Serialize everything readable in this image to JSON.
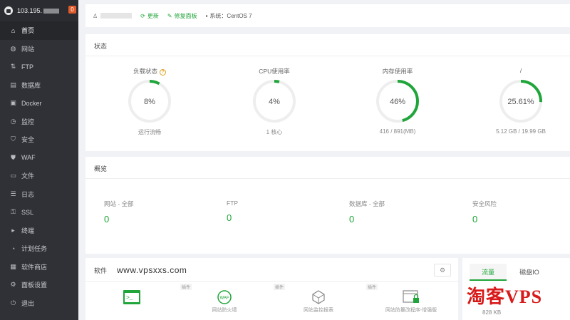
{
  "sidebar": {
    "ip": "103.195.",
    "badge": "0",
    "items": [
      {
        "label": "首页",
        "icon": "home-icon",
        "glyph": "⌂",
        "active": true
      },
      {
        "label": "网站",
        "icon": "globe-icon",
        "glyph": "◍"
      },
      {
        "label": "FTP",
        "icon": "ftp-icon",
        "glyph": "⇅"
      },
      {
        "label": "数据库",
        "icon": "database-icon",
        "glyph": "▤"
      },
      {
        "label": "Docker",
        "icon": "docker-icon",
        "glyph": "▣"
      },
      {
        "label": "监控",
        "icon": "monitor-icon",
        "glyph": "◷"
      },
      {
        "label": "安全",
        "icon": "shield-icon",
        "glyph": "⛉"
      },
      {
        "label": "WAF",
        "icon": "waf-icon",
        "glyph": "⛊"
      },
      {
        "label": "文件",
        "icon": "folder-icon",
        "glyph": "▭"
      },
      {
        "label": "日志",
        "icon": "log-icon",
        "glyph": "☰"
      },
      {
        "label": "SSL",
        "icon": "ssl-icon",
        "glyph": "⚿"
      },
      {
        "label": "终端",
        "icon": "terminal-icon",
        "glyph": "▸"
      },
      {
        "label": "计划任务",
        "icon": "clock-icon",
        "glyph": "◔"
      },
      {
        "label": "软件商店",
        "icon": "store-icon",
        "glyph": "▦"
      },
      {
        "label": "面板设置",
        "icon": "gear-icon",
        "glyph": "⚙"
      },
      {
        "label": "退出",
        "icon": "logout-icon",
        "glyph": "⏻"
      }
    ]
  },
  "topbar": {
    "links": [
      {
        "label": "更新",
        "icon": "update-icon"
      },
      {
        "label": "修复面板",
        "icon": "repair-icon"
      }
    ],
    "system": "系统：CentOS 7"
  },
  "status": {
    "title": "状态",
    "gauges": [
      {
        "title": "负载状态",
        "value": "8%",
        "percent": 8,
        "sub": "运行流畅",
        "help": true
      },
      {
        "title": "CPU使用率",
        "value": "4%",
        "percent": 4,
        "sub": "1 核心"
      },
      {
        "title": "内存使用率",
        "value": "46%",
        "percent": 46,
        "sub": "416 / 891(MB)"
      },
      {
        "title": "/",
        "value": "25.61%",
        "percent": 25.61,
        "sub": "5.12 GB / 19.99 GB"
      }
    ]
  },
  "overview": {
    "title": "概览",
    "items": [
      {
        "label": "网站 - 全部",
        "value": "0"
      },
      {
        "label": "FTP",
        "value": "0"
      },
      {
        "label": "数据库 - 全部",
        "value": "0"
      },
      {
        "label": "安全风险",
        "value": "0"
      }
    ]
  },
  "software": {
    "title": "软件",
    "watermark": "www.vpsxxs.com",
    "items": [
      {
        "name": "",
        "tag": "",
        "icon": "terminal-app-icon"
      },
      {
        "name": "网站防火墙",
        "tag": "插件",
        "icon": "waf-app-icon"
      },
      {
        "name": "网站监控报表",
        "tag": "插件",
        "icon": "report-app-icon"
      },
      {
        "name": "网站防篡改程序-增强版",
        "tag": "插件",
        "icon": "tamper-app-icon"
      }
    ]
  },
  "traffic": {
    "tabs": [
      "流量",
      "磁盘IO"
    ],
    "active_tab": 0,
    "value": "828 KB"
  },
  "watermark_brand": "淘客VPS",
  "colors": {
    "accent": "#20a53a",
    "sidebar_bg": "#2f3137",
    "warning": "#e0a020"
  }
}
